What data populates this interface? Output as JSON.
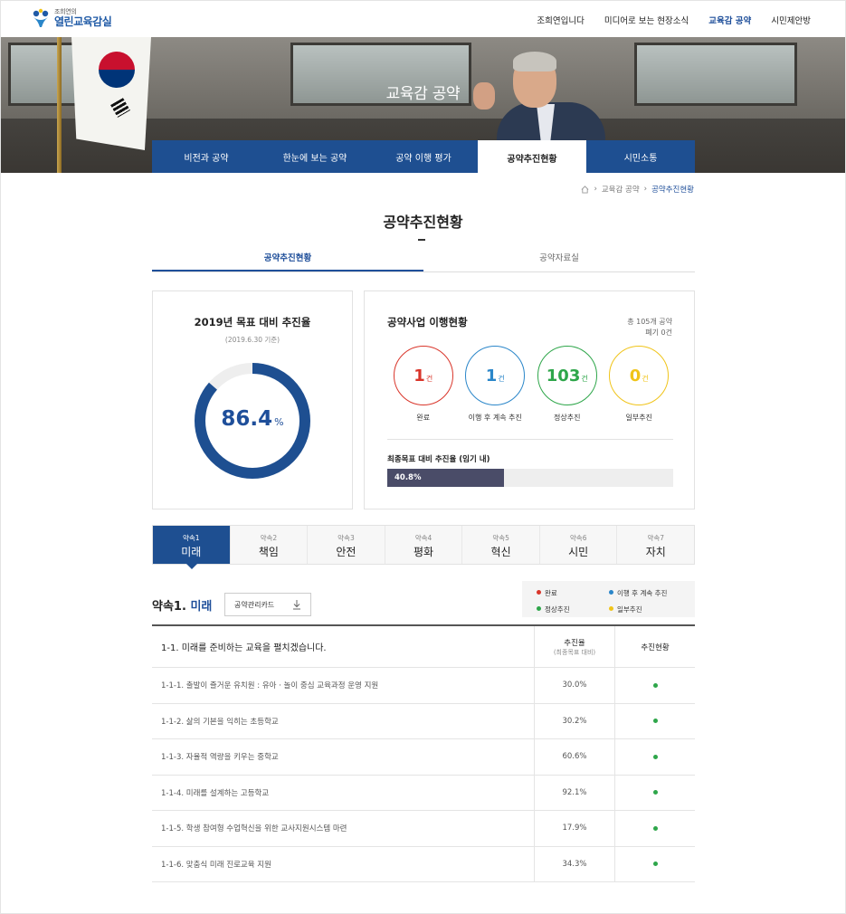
{
  "header": {
    "logo_sub": "조희연의",
    "logo_main": "열린교육감실",
    "nav": [
      "조희연입니다",
      "미디어로 보는 현장소식",
      "교육감 공약",
      "시민제안방"
    ]
  },
  "hero": {
    "title": "교육감 공약",
    "tabs": [
      "비전과 공약",
      "한눈에 보는 공약",
      "공약 이행 평가",
      "공약추진현황",
      "시민소통"
    ]
  },
  "breadcrumb": [
    "교육감 공약",
    "공약추진현황"
  ],
  "page_title": "공약추진현황",
  "subtabs": [
    "공약추진현황",
    "공약자료실"
  ],
  "target_card": {
    "title": "2019년 목표 대비 추진율",
    "date": "(2019.6.30 기준)",
    "value": "86.4",
    "unit": "%",
    "ratio": 0.864
  },
  "status_card": {
    "title": "공약사업 이행현황",
    "total_line1": "총 105개 공약",
    "total_line2": "폐기 0건",
    "items": [
      {
        "value": "1",
        "unit": "건",
        "label": "완료",
        "color": "#d9352a"
      },
      {
        "value": "1",
        "unit": "건",
        "label": "이행 후 계속 추진",
        "color": "#2a86c9"
      },
      {
        "value": "103",
        "unit": "건",
        "label": "정상추진",
        "color": "#2ea64a"
      },
      {
        "value": "0",
        "unit": "건",
        "label": "일부추진",
        "color": "#f0c419"
      }
    ],
    "progress_title": "최종목표 대비 추진율 (임기 내)",
    "progress_label": "40.8%",
    "progress_value": 0.408
  },
  "pledge_tabs": [
    {
      "num": "약속1",
      "name": "미래"
    },
    {
      "num": "약속2",
      "name": "책임"
    },
    {
      "num": "약속3",
      "name": "안전"
    },
    {
      "num": "약속4",
      "name": "평화"
    },
    {
      "num": "약속5",
      "name": "혁신"
    },
    {
      "num": "약속6",
      "name": "시민"
    },
    {
      "num": "약속7",
      "name": "자치"
    }
  ],
  "section": {
    "prefix": "약속1.",
    "name": "미래",
    "button": "공약관리카드"
  },
  "legend": [
    {
      "label": "완료",
      "color": "#d9352a"
    },
    {
      "label": "이행 후 계속 추진",
      "color": "#2a86c9"
    },
    {
      "label": "정상추진",
      "color": "#2ea64a"
    },
    {
      "label": "일부추진",
      "color": "#f0c419"
    }
  ],
  "table": {
    "head": {
      "title": "1-1. 미래를 준비하는 교육을 펼치겠습니다.",
      "col2": "추진율",
      "col2_sub": "(최종목표 대비)",
      "col3": "추진현황"
    },
    "rows": [
      {
        "title": "1-1-1. 출발이 즐거운 유치원 : 유아 · 놀이 중심 교육과정 운영 지원",
        "rate": "30.0%",
        "status": "정상추진"
      },
      {
        "title": "1-1-2. 삶의 기본을 익히는 초등학교",
        "rate": "30.2%",
        "status": "정상추진"
      },
      {
        "title": "1-1-3. 자율적 역량을 키우는 중학교",
        "rate": "60.6%",
        "status": "정상추진"
      },
      {
        "title": "1-1-4. 미래를 설계하는 고등학교",
        "rate": "92.1%",
        "status": "정상추진"
      },
      {
        "title": "1-1-5. 학생 참여형 수업혁신을 위한 교사지원시스템 마련",
        "rate": "17.9%",
        "status": "정상추진"
      },
      {
        "title": "1-1-6. 맞춤식 미래 진로교육 지원",
        "rate": "34.3%",
        "status": "정상추진"
      }
    ]
  }
}
